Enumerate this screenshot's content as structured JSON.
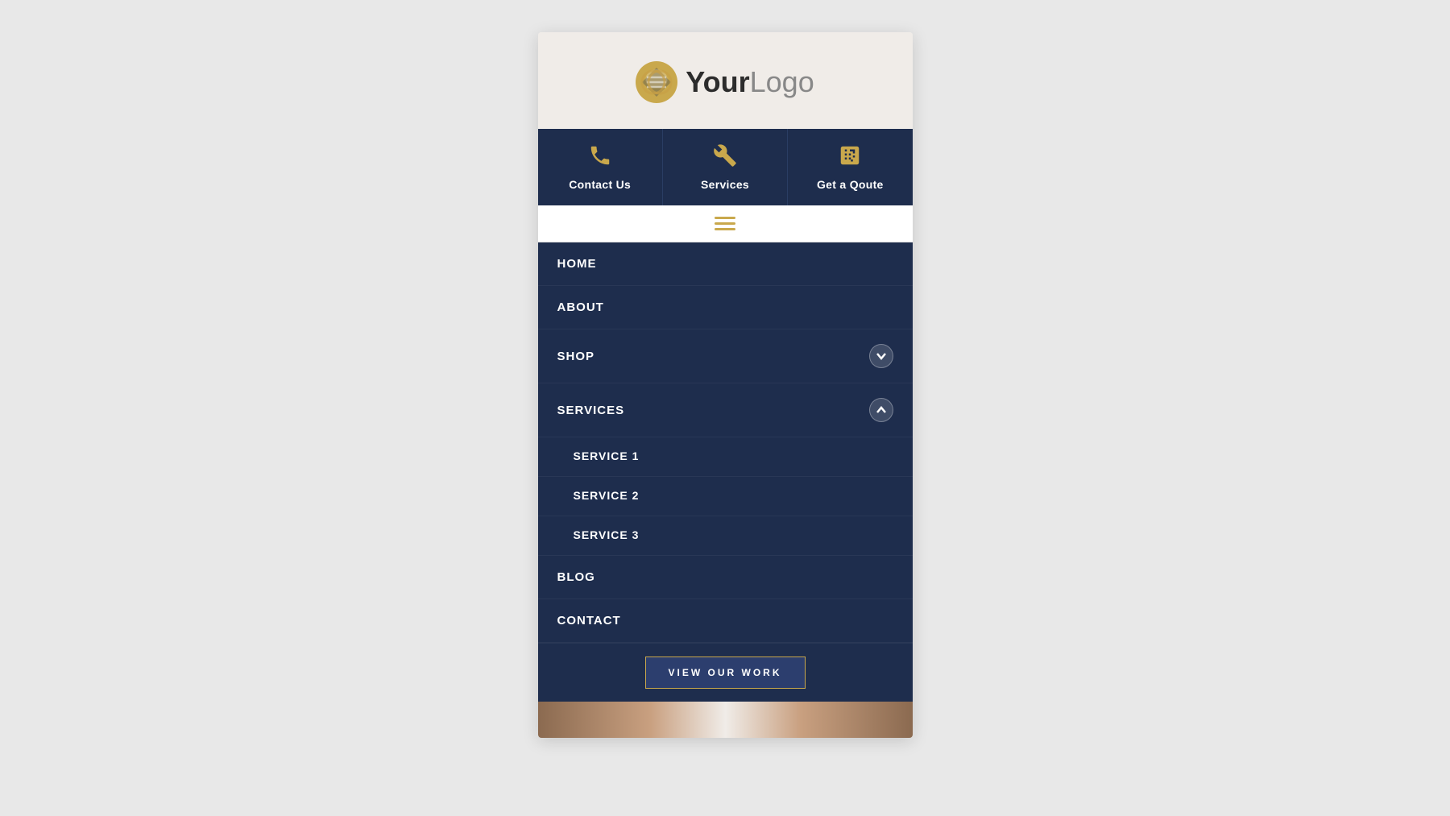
{
  "header": {
    "logo_bold": "Your",
    "logo_light": "Logo"
  },
  "top_nav": {
    "items": [
      {
        "id": "contact-us",
        "icon": "phone",
        "label": "Contact Us"
      },
      {
        "id": "services",
        "icon": "wrench",
        "label": "Services"
      },
      {
        "id": "get-quote",
        "icon": "calculator",
        "label": "Get a Qoute"
      }
    ]
  },
  "nav_menu": {
    "items": [
      {
        "id": "home",
        "label": "HOME",
        "has_dropdown": false,
        "dropdown_open": false
      },
      {
        "id": "about",
        "label": "ABOUT",
        "has_dropdown": false,
        "dropdown_open": false
      },
      {
        "id": "shop",
        "label": "SHOP",
        "has_dropdown": true,
        "dropdown_open": false
      },
      {
        "id": "services",
        "label": "SERVICES",
        "has_dropdown": true,
        "dropdown_open": true,
        "subitems": [
          {
            "id": "service-1",
            "label": "SERVICE 1"
          },
          {
            "id": "service-2",
            "label": "SERVICE 2"
          },
          {
            "id": "service-3",
            "label": "SERVICE 3"
          }
        ]
      },
      {
        "id": "blog",
        "label": "BLOG",
        "has_dropdown": false,
        "dropdown_open": false
      },
      {
        "id": "contact",
        "label": "CONTACT",
        "has_dropdown": false,
        "dropdown_open": false
      }
    ]
  },
  "cta": {
    "button_label": "VIEW OUR WORK"
  },
  "colors": {
    "navy": "#1e2d4d",
    "gold": "#c9a84c",
    "white": "#ffffff",
    "light_bg": "#f0ece8"
  }
}
